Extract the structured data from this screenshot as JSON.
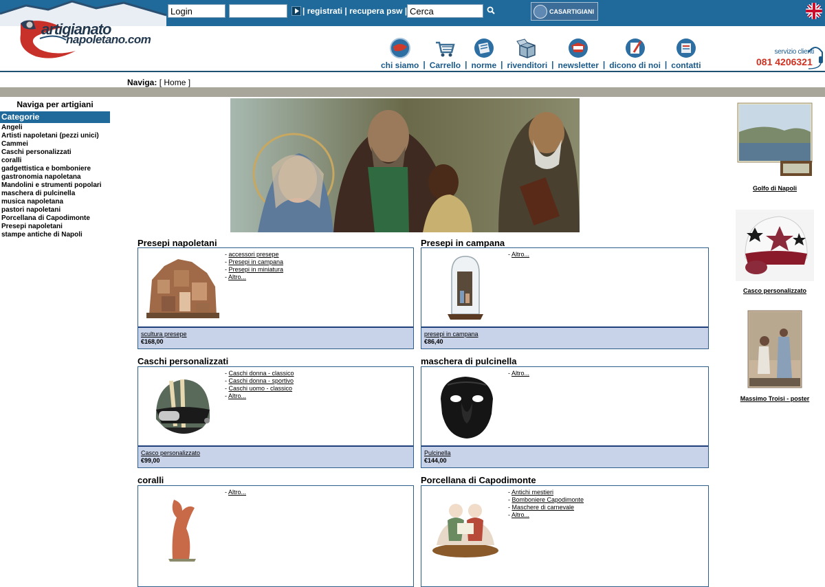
{
  "header": {
    "logo_text_1": "artigianato",
    "logo_text_2": "napoletano.com",
    "login_value": "Login",
    "password_value": "",
    "links": [
      "registrati",
      "recupera psw"
    ],
    "search_value": "Cerca",
    "partner_label": "CASARTIGIANI",
    "flag_icon": "uk-flag-icon"
  },
  "nav": {
    "items": [
      {
        "label": "chi siamo",
        "icon": "info-icon"
      },
      {
        "label": "Carrello",
        "icon": "cart-icon"
      },
      {
        "label": "norme",
        "icon": "rules-icon"
      },
      {
        "label": "rivenditori",
        "icon": "box-icon"
      },
      {
        "label": "newsletter",
        "icon": "news-icon"
      },
      {
        "label": "dicono di noi",
        "icon": "testimonial-icon"
      },
      {
        "label": "contatti",
        "icon": "contact-icon"
      }
    ],
    "separator": "|"
  },
  "service": {
    "label": "servizio clienti",
    "phone": "081 4206321"
  },
  "breadcrumb": {
    "label": "Naviga:",
    "bracket_open": "[",
    "home": "Home",
    "bracket_close": "]"
  },
  "sidebar": {
    "heading": "Naviga per artigiani",
    "category_title": "Categorie",
    "categories": [
      "Angeli",
      "Artisti napoletani (pezzi unici)",
      "Cammei",
      "Caschi personalizzati",
      "coralli",
      "gadgettistica e bomboniere",
      "gastronomia napoletana",
      "Mandolini e strumenti popolari",
      "maschera di pulcinella",
      "musica napoletana",
      "pastori napoletani",
      "Porcellana di Capodimonte",
      "Presepi napoletani",
      "stampe antiche di Napoli"
    ]
  },
  "products": [
    {
      "title": "Presepi napoletani",
      "links": [
        "accessori presepe",
        "Presepi in campana",
        "Presepi in miniatura",
        "Altro..."
      ],
      "item": "scultura presepe",
      "price": "€168,00",
      "image": "presepe-image"
    },
    {
      "title": "Presepi in campana",
      "links": [
        "Altro..."
      ],
      "item": "presepi in campana",
      "price": "€86,40",
      "image": "campana-image"
    },
    {
      "title": "Caschi personalizzati",
      "links": [
        "Caschi donna - classico",
        "Caschi donna - sportivo",
        "Caschi uomo - classico",
        "Altro..."
      ],
      "item": "Casco personalizzato",
      "price": "€99,00",
      "image": "helmet-image"
    },
    {
      "title": "maschera di pulcinella",
      "links": [
        "Altro..."
      ],
      "item": "Pulcinella",
      "price": "€144,00",
      "image": "mask-image"
    },
    {
      "title": "coralli",
      "links": [
        "Altro..."
      ],
      "item": "",
      "price": "",
      "image": "coral-image"
    },
    {
      "title": "Porcellana di Capodimonte",
      "links": [
        "Antichi mestieri",
        "Bomboniere Capodimonte",
        "Maschere di carnevale",
        "Altro..."
      ],
      "item": "",
      "price": "",
      "image": "porcelain-image"
    }
  ],
  "right_column": [
    {
      "caption": "Golfo di Napoli",
      "image": "gulf-painting-image"
    },
    {
      "caption": "Casco personalizzato",
      "image": "star-helmet-image"
    },
    {
      "caption": "Massimo Troisi - poster",
      "image": "troisi-poster-image"
    }
  ]
}
